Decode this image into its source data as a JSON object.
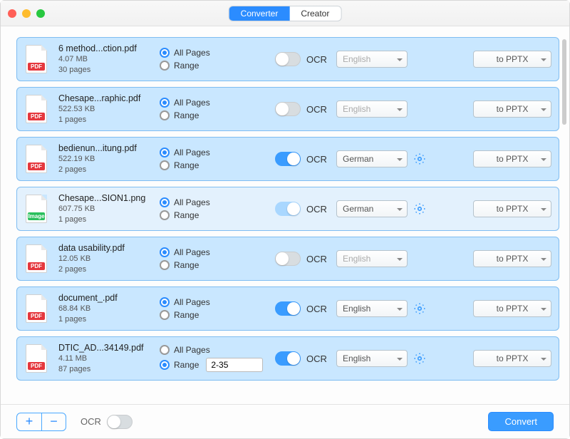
{
  "tabs": {
    "converter": "Converter",
    "creator": "Creator"
  },
  "labels": {
    "all_pages": "All Pages",
    "range": "Range",
    "ocr": "OCR",
    "convert": "Convert"
  },
  "files": [
    {
      "name": "6 method...ction.pdf",
      "size": "4.07 MB",
      "pages": "30 pages",
      "type": "PDF",
      "page_mode": "all",
      "range_value": "",
      "ocr_on": false,
      "lang": "English",
      "lang_enabled": false,
      "show_gear": false,
      "output": "to PPTX",
      "row_light": false
    },
    {
      "name": "Chesape...raphic.pdf",
      "size": "522.53 KB",
      "pages": "1 pages",
      "type": "PDF",
      "page_mode": "all",
      "range_value": "",
      "ocr_on": false,
      "lang": "English",
      "lang_enabled": false,
      "show_gear": false,
      "output": "to PPTX",
      "row_light": false
    },
    {
      "name": "bedienun...itung.pdf",
      "size": "522.19 KB",
      "pages": "2 pages",
      "type": "PDF",
      "page_mode": "all",
      "range_value": "",
      "ocr_on": true,
      "lang": "German",
      "lang_enabled": true,
      "show_gear": true,
      "output": "to PPTX",
      "row_light": false
    },
    {
      "name": "Chesape...SION1.png",
      "size": "607.75 KB",
      "pages": "1 pages",
      "type": "Image",
      "page_mode": "all",
      "range_value": "",
      "ocr_on": true,
      "ocr_light": true,
      "lang": "German",
      "lang_enabled": true,
      "show_gear": true,
      "output": "to PPTX",
      "row_light": true
    },
    {
      "name": "data usability.pdf",
      "size": "12.05 KB",
      "pages": "2 pages",
      "type": "PDF",
      "page_mode": "all",
      "range_value": "",
      "ocr_on": false,
      "lang": "English",
      "lang_enabled": false,
      "show_gear": false,
      "output": "to PPTX",
      "row_light": false
    },
    {
      "name": "document_.pdf",
      "size": "68.84 KB",
      "pages": "1 pages",
      "type": "PDF",
      "page_mode": "all",
      "range_value": "",
      "ocr_on": true,
      "lang": "English",
      "lang_enabled": true,
      "show_gear": true,
      "output": "to PPTX",
      "row_light": false
    },
    {
      "name": "DTIC_AD...34149.pdf",
      "size": "4.11 MB",
      "pages": "87 pages",
      "type": "PDF",
      "page_mode": "range",
      "range_value": "2-35",
      "ocr_on": true,
      "lang": "English",
      "lang_enabled": true,
      "show_gear": true,
      "output": "to PPTX",
      "row_light": false
    }
  ],
  "footer": {
    "ocr_label": "OCR",
    "global_ocr_on": false
  }
}
